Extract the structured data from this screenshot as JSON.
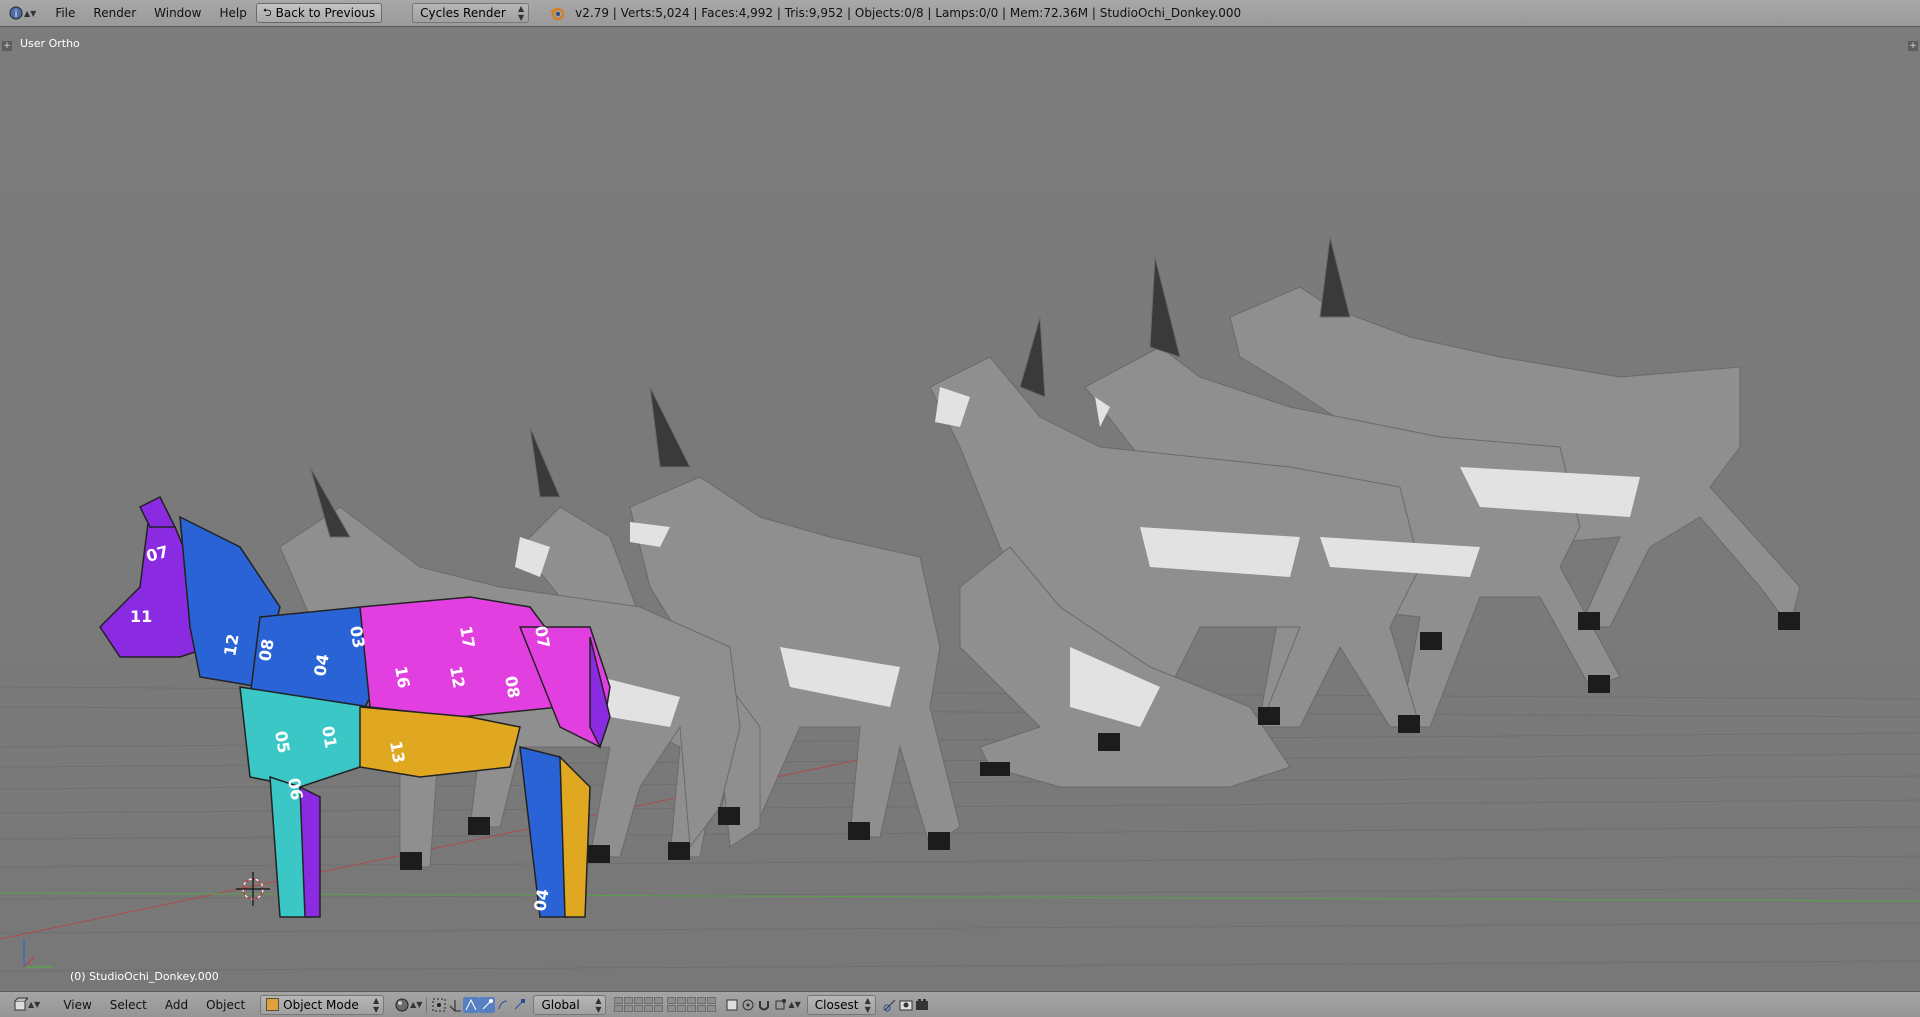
{
  "header": {
    "menus": [
      "File",
      "Render",
      "Window",
      "Help"
    ],
    "back_button": "Back to Previous",
    "render_engine": "Cycles Render",
    "stats": "v2.79 | Verts:5,024 | Faces:4,992 | Tris:9,952 | Objects:0/8 | Lamps:0/0 | Mem:72.36M | StudioOchi_Donkey.000"
  },
  "viewport": {
    "view_label": "User Ortho",
    "object_label": "(0) StudioOchi_Donkey.000",
    "uv_numbers": [
      "07",
      "11",
      "08",
      "12",
      "04",
      "05",
      "01",
      "06",
      "13",
      "16",
      "12",
      "08",
      "07",
      "17",
      "03",
      "04"
    ]
  },
  "footer": {
    "menus": [
      "View",
      "Select",
      "Add",
      "Object"
    ],
    "mode": "Object Mode",
    "orientation": "Global",
    "snap": "Closest"
  },
  "colors": {
    "background": "#7b7b7b",
    "uv_purple": "#8a2be2",
    "uv_blue": "#2a63d6",
    "uv_teal": "#3cc7c7",
    "uv_magenta": "#e23fe0",
    "uv_yellow": "#e0a820",
    "donkey_gray": "#8c8c8c"
  }
}
